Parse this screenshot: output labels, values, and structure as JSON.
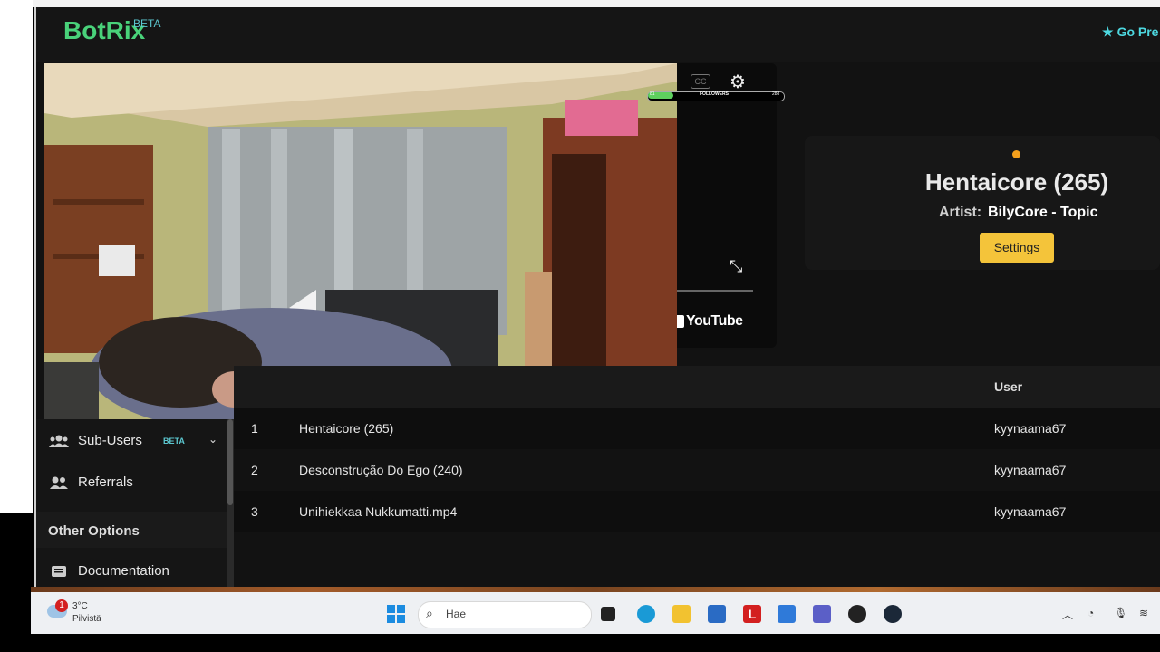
{
  "header": {
    "logo": "BotRix",
    "logo_sup": "BETA",
    "premium": "Go Pre"
  },
  "sidebar": {
    "items": [
      {
        "label": "Sub-Users",
        "badge": "BETA"
      },
      {
        "label": "Referrals"
      }
    ],
    "section": "Other Options",
    "section_items": [
      {
        "label": "Documentation"
      }
    ]
  },
  "player": {
    "cc": "CC",
    "youtube": "YouTube",
    "followers_label": "FOLLOWERS",
    "followers_current": "81",
    "followers_goal": "288",
    "followers_progress": 0.19
  },
  "now_playing": {
    "title": "Hentaicore (265)",
    "artist_label": "Artist:",
    "artist": "BilyCore - Topic",
    "settings": "Settings"
  },
  "queue": {
    "headers": {
      "user": "User"
    },
    "rows": [
      {
        "num": "1",
        "song": "Hentaicore (265)",
        "user": "kyynaama67"
      },
      {
        "num": "2",
        "song": "Desconstrução Do Ego (240)",
        "user": "kyynaama67"
      },
      {
        "num": "3",
        "song": "Unihiekkaa Nukkumatti.mp4",
        "user": "kyynaama67"
      }
    ]
  },
  "taskbar": {
    "weather_badge": "1",
    "temp": "3°C",
    "condition": "Pilvistä",
    "search_placeholder": "Hae"
  },
  "colors": {
    "brand": "#49d27a",
    "accent": "#f4c43a",
    "badge": "#5cc7d0"
  }
}
